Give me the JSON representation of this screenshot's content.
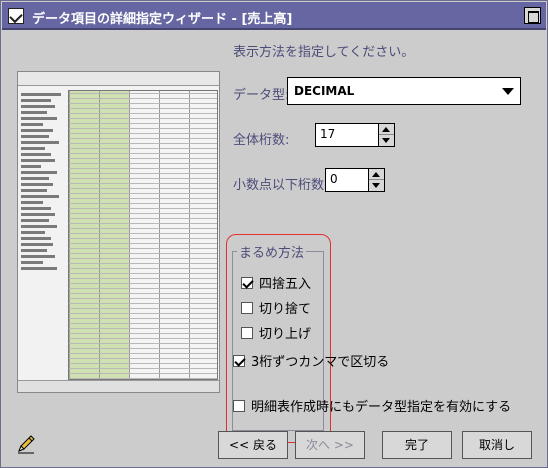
{
  "window": {
    "title": "データ項目の詳細指定ウィザード - [売上高]"
  },
  "instruction": "表示方法を指定してください。",
  "data_type": {
    "label": "データ型:",
    "value": "DECIMAL"
  },
  "total_digits": {
    "label": "全体桁数:",
    "value": "17"
  },
  "decimal_digits": {
    "label": "小数点以下桁数:",
    "value": "0"
  },
  "rounding": {
    "title": "まるめ方法",
    "options": [
      {
        "label": "四捨五入",
        "checked": true
      },
      {
        "label": "切り捨て",
        "checked": false
      },
      {
        "label": "切り上げ",
        "checked": false
      }
    ]
  },
  "comma_option": {
    "label": "3桁ずつカンマで区切る",
    "checked": true
  },
  "detail_option": {
    "label": "明細表作成時にもデータ型指定を有効にする",
    "checked": false
  },
  "buttons": {
    "back": "<< 戻る",
    "next": "次へ >>",
    "finish": "完了",
    "cancel": "取消し"
  }
}
